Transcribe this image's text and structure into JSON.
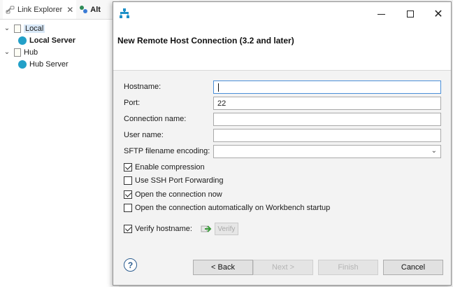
{
  "explorer": {
    "tab_link_explorer": "Link Explorer",
    "tab_second": "Alt",
    "tree": [
      {
        "label": "Local",
        "type": "folder",
        "expanded": true,
        "selected": true
      },
      {
        "label": "Local Server",
        "type": "server",
        "bold": true
      },
      {
        "label": "Hub",
        "type": "folder",
        "expanded": true
      },
      {
        "label": "Hub Server",
        "type": "server"
      }
    ]
  },
  "dialog": {
    "heading": "New Remote Host Connection (3.2 and later)",
    "fields": {
      "hostname_label": "Hostname:",
      "hostname_value": "",
      "port_label": "Port:",
      "port_value": "22",
      "connection_name_label": "Connection name:",
      "connection_name_value": "",
      "user_name_label": "User name:",
      "user_name_value": "",
      "sftp_encoding_label": "SFTP filename encoding:",
      "sftp_encoding_value": ""
    },
    "checkboxes": {
      "enable_compression": {
        "label": "Enable compression",
        "checked": true
      },
      "use_ssh_port_forwarding": {
        "label": "Use SSH Port Forwarding",
        "checked": false
      },
      "open_connection_now": {
        "label": "Open the connection now",
        "checked": true
      },
      "open_on_startup": {
        "label": "Open the connection automatically on Workbench startup",
        "checked": false
      },
      "verify_hostname": {
        "label": "Verify hostname:",
        "checked": true
      }
    },
    "verify_button": "Verify",
    "buttons": {
      "back": "< Back",
      "next": "Next >",
      "finish": "Finish",
      "cancel": "Cancel"
    },
    "help_glyph": "?"
  },
  "colors": {
    "accent": "#22a0c8",
    "focus_border": "#4a8fd8"
  }
}
